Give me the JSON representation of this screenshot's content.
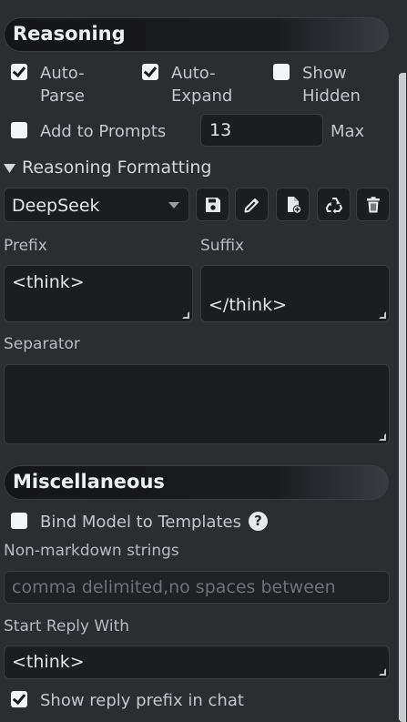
{
  "reasoning": {
    "header": "Reasoning",
    "auto_parse": {
      "label_line1": "Auto-",
      "label_line2": "Parse",
      "checked": true
    },
    "auto_expand": {
      "label_line1": "Auto-",
      "label_line2": "Expand",
      "checked": true
    },
    "show_hidden": {
      "label_line1": "Show",
      "label_line2": "Hidden",
      "checked": false
    },
    "add_to_prompts": {
      "label": "Add to Prompts",
      "checked": false
    },
    "max_value": "13",
    "max_label": "Max",
    "formatting_title": "Reasoning Formatting",
    "template_select": "DeepSeek",
    "prefix_label": "Prefix",
    "prefix_value": "<think>",
    "suffix_label": "Suffix",
    "suffix_value": "</think>",
    "separator_label": "Separator",
    "separator_value": ""
  },
  "misc": {
    "header": "Miscellaneous",
    "bind_model": {
      "label": "Bind Model to Templates",
      "checked": false
    },
    "help_glyph": "?",
    "non_markdown_label": "Non-markdown strings",
    "non_markdown_placeholder": "comma delimited,no spaces between",
    "start_reply_label": "Start Reply With",
    "start_reply_value": "<think>",
    "show_reply_prefix": {
      "label": "Show reply prefix in chat",
      "checked": true
    }
  },
  "icons": [
    "save-icon",
    "pencil-icon",
    "file-plus-icon",
    "recycle-icon",
    "trash-icon",
    "chevron-down-icon",
    "triangle-down-icon"
  ]
}
